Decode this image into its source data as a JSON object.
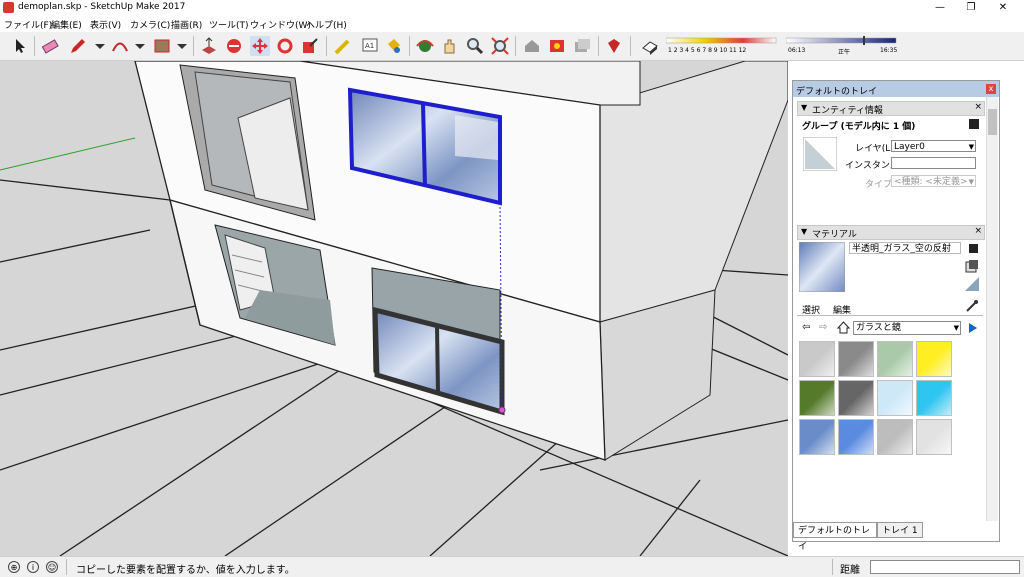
{
  "window": {
    "title": "demoplan.skp - SketchUp Make 2017",
    "min_glyph": "—",
    "max_glyph": "❐",
    "close_glyph": "✕"
  },
  "menu": [
    "ファイル(F)",
    "編集(E)",
    "表示(V)",
    "カメラ(C)",
    "描画(R)",
    "ツール(T)",
    "ウィンドウ(W)",
    "ヘルプ(H)"
  ],
  "toolbar": {
    "tools": [
      "select-icon",
      "eraser-icon",
      "pencil-icon",
      "arc-icon",
      "rectangle-icon",
      "push-pull-icon",
      "follow-me-icon",
      "move-icon",
      "rotate-icon",
      "scale-icon",
      "tape-measure-icon",
      "text-label-icon",
      "paint-bucket-icon",
      "orbit-icon",
      "pan-icon",
      "zoom-icon",
      "zoom-extents-icon",
      "warehouse-icon",
      "extension-icon",
      "share-model-icon",
      "ruby-icon",
      "shadows-toggle-icon"
    ],
    "shadow_months": "1 2 3 4 5 6 7 8 9 10 11 12",
    "shadow_time_start": "06:13",
    "shadow_time_noon": "正午",
    "shadow_time_end": "16:35"
  },
  "tray": {
    "title": "デフォルトのトレイ",
    "close": "x",
    "entity_info": {
      "header": "エンティティ情報",
      "entity_label": "グループ (モデル内に 1 個)",
      "layer_label": "レイヤ(L):",
      "layer_value": "Layer0",
      "instance_label": "インスタンス:",
      "instance_value": "",
      "type_label": "タイプ:",
      "type_value": "<種類: <未定義>"
    },
    "materials": {
      "header": "マテリアル",
      "current_name": "半透明_ガラス_空の反射",
      "tab_select": "選択",
      "tab_edit": "編集",
      "collection": "ガラスと鏡",
      "swatch_colors": [
        "#c9c9c9",
        "#8a8a8a",
        "#a9c9a9",
        "#ffee22",
        "#557a2a",
        "#666666",
        "#cfe8f8",
        "#2ec5f0",
        "#6a8cc8",
        "#5b8be0",
        "#bdbdbd",
        "#e2e2e2"
      ]
    },
    "tabs": [
      "デフォルトのトレイ",
      "トレイ 1"
    ]
  },
  "status": {
    "message": "コピーした要素を配置するか、値を入力します。",
    "measure_label": "距離",
    "measure_value": ""
  },
  "colors": {
    "selection_blue": "#1e1ecc",
    "tray_title_bg": "#b7cbe5",
    "viewport_ground": "#d6d6d6"
  }
}
